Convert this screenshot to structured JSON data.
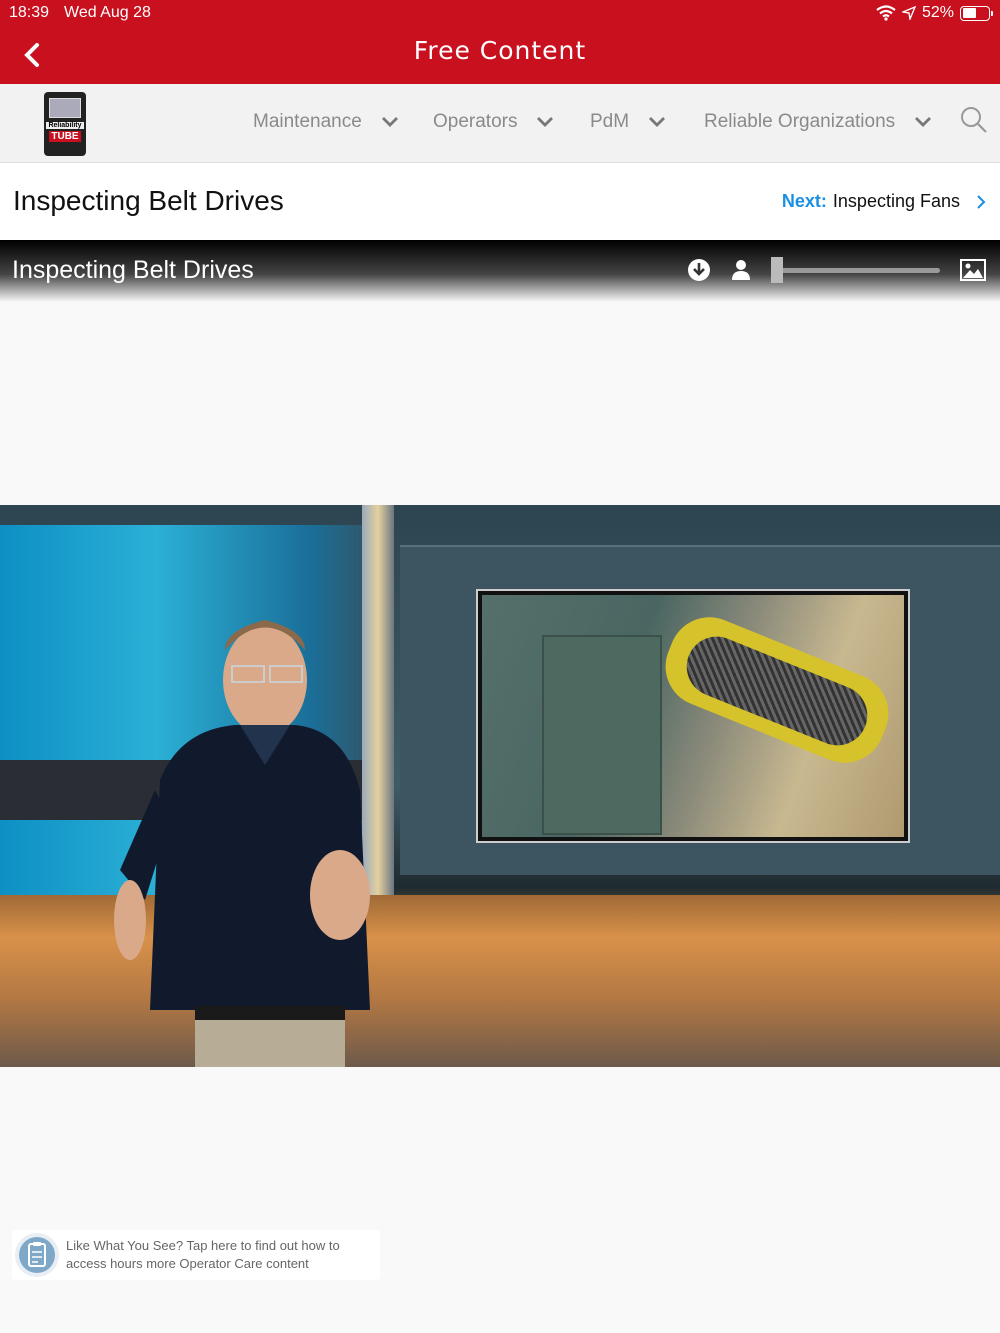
{
  "status_bar": {
    "time": "18:39",
    "date": "Wed Aug 28",
    "battery": "52%",
    "battery_level": 0.52
  },
  "header": {
    "title": "Free Content"
  },
  "navigation": {
    "logo": {
      "line1": "Reliability",
      "line2": "TUBE"
    },
    "items": [
      {
        "label": "Maintenance"
      },
      {
        "label": "Operators"
      },
      {
        "label": "PdM"
      },
      {
        "label": "Reliable Organizations"
      }
    ]
  },
  "content_header": {
    "title": "Inspecting Belt Drives",
    "next_label": "Next:",
    "next_title": "Inspecting Fans"
  },
  "video": {
    "title": "Inspecting Belt Drives",
    "slider_value": 0
  },
  "promo": {
    "line1": "Like What You See? Tap here to find out how to",
    "line2": "access hours more Operator Care content"
  }
}
